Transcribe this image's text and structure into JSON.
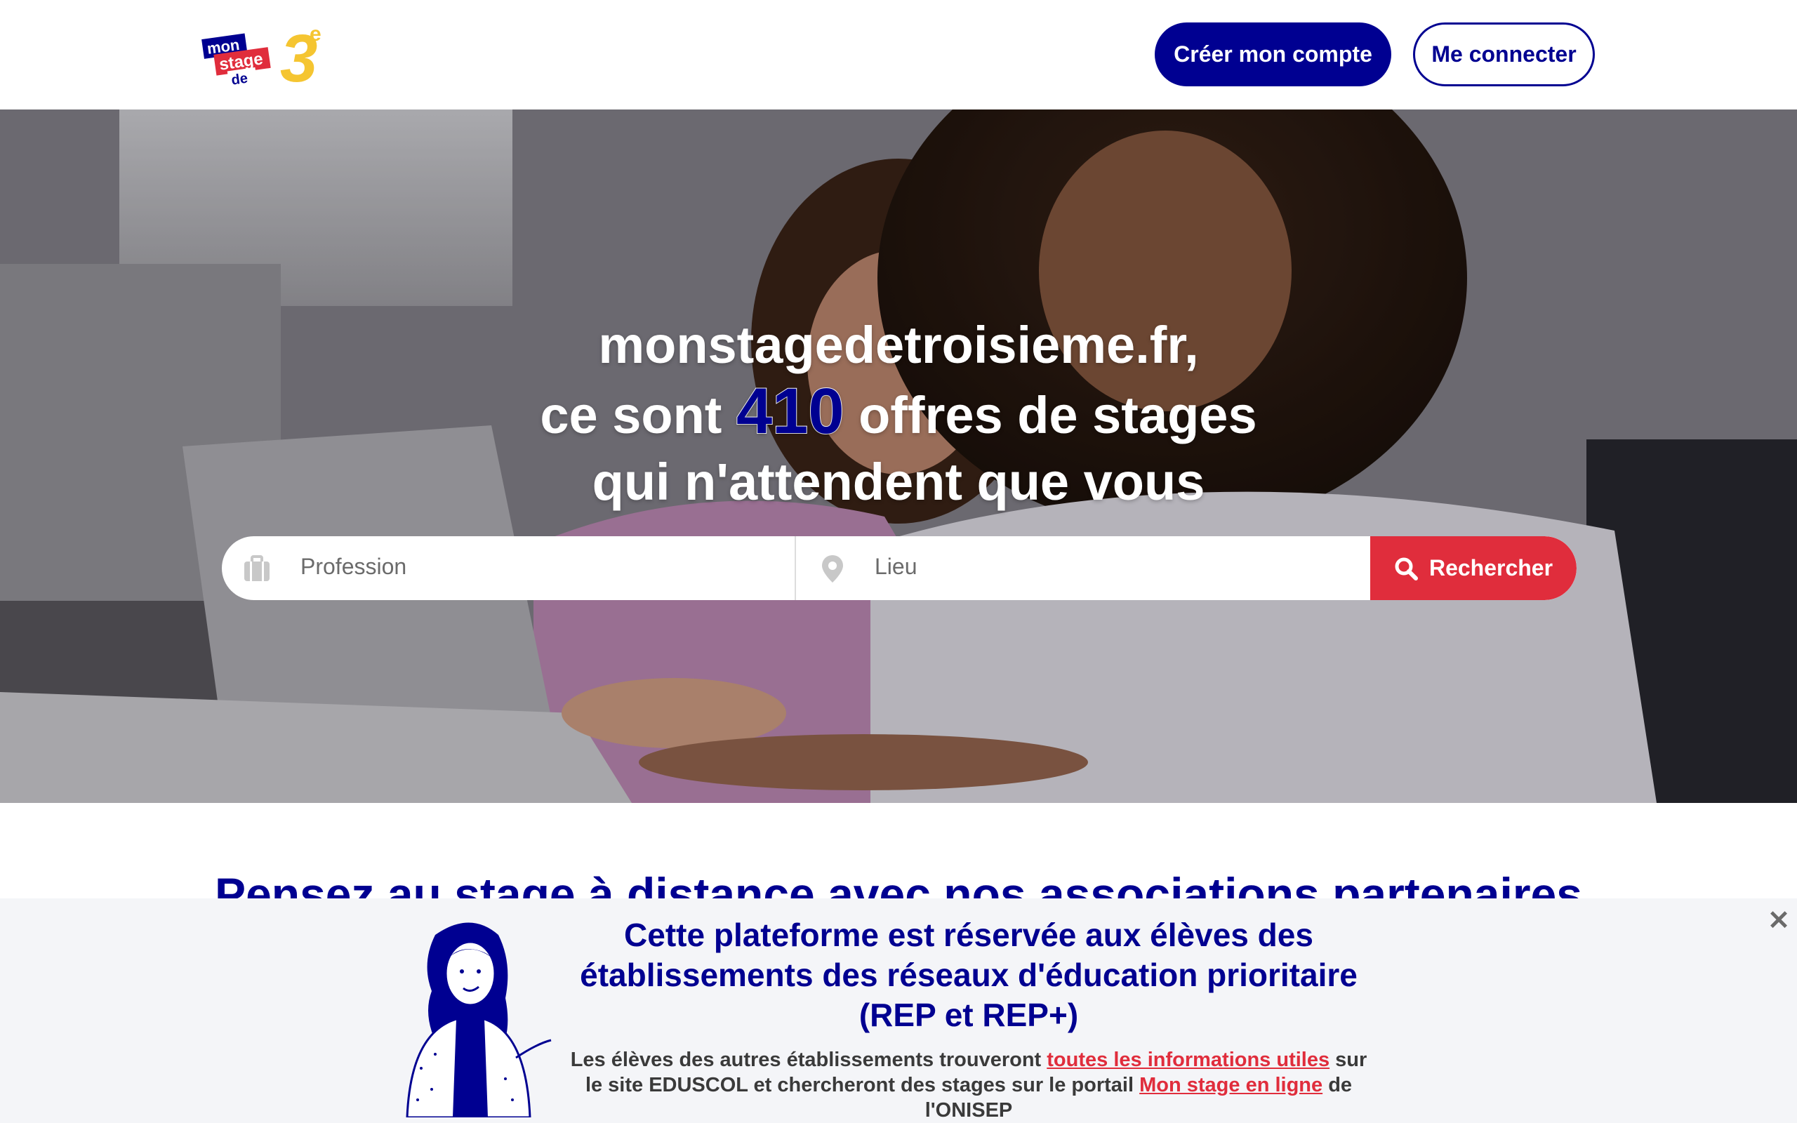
{
  "header": {
    "logo": {
      "line1": "mon",
      "line2": "stage",
      "line3": "de",
      "numeral": "3",
      "suffix": "e"
    },
    "create_account_label": "Créer mon compte",
    "login_label": "Me connecter"
  },
  "hero": {
    "line1": "monstagedetroisieme.fr,",
    "line2_prefix": "ce sont ",
    "offer_count": "410",
    "line2_suffix": " offres de stages",
    "line3": "qui n'attendent que vous"
  },
  "search": {
    "profession_placeholder": "Profession",
    "location_placeholder": "Lieu",
    "search_label": "Rechercher",
    "icons": [
      "briefcase-icon",
      "location-pin-icon",
      "search-icon"
    ]
  },
  "section": {
    "title": "Pensez au stage à distance avec nos associations partenaires"
  },
  "banner": {
    "title": "Cette plateforme est réservée aux élèves des établissements des réseaux d'éducation prioritaire (REP et REP+)",
    "text_part1": "Les élèves des autres établissements trouveront ",
    "link1": "toutes les informations utiles",
    "text_part2": " sur le site EDUSCOL et chercheront des stages sur le portail ",
    "link2": "Mon stage en ligne",
    "text_part3": " de l'ONISEP",
    "close_symbol": "✕"
  },
  "colors": {
    "primary": "#000091",
    "accent_red": "#e02d3c",
    "logo_yellow": "#f5c531",
    "banner_bg": "#f4f5f8"
  }
}
